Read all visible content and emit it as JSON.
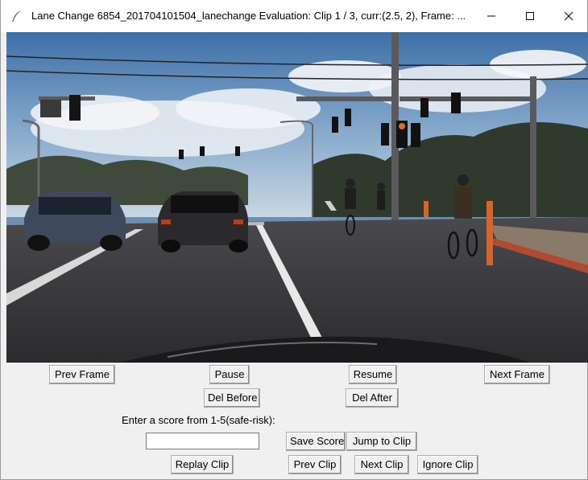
{
  "window": {
    "title": "Lane Change 6854_201704101504_lanechange Evaluation: Clip 1 / 3, curr:(2.5, 2), Frame: ...",
    "controls": {
      "minimize": "minimize",
      "maximize": "maximize",
      "close": "close"
    }
  },
  "icons": {
    "app": "feather-icon",
    "minimize": "minimize-icon",
    "maximize": "maximize-icon",
    "close": "close-icon"
  },
  "video": {
    "description": "dashcam frame"
  },
  "buttons": {
    "prev_frame": "Prev Frame",
    "pause": "Pause",
    "resume": "Resume",
    "next_frame": "Next Frame",
    "del_before": "Del Before",
    "del_after": "Del After",
    "save_score": "Save Score",
    "jump_to_clip": "Jump to Clip",
    "replay_clip": "Replay Clip",
    "prev_clip": "Prev Clip",
    "next_clip": "Next Clip",
    "ignore_clip": "Ignore Clip"
  },
  "score": {
    "prompt": "Enter a score from 1-5(safe-risk):",
    "value": ""
  },
  "colors": {
    "window_bg": "#f0f0f0",
    "titlebar_bg": "#ffffff"
  }
}
